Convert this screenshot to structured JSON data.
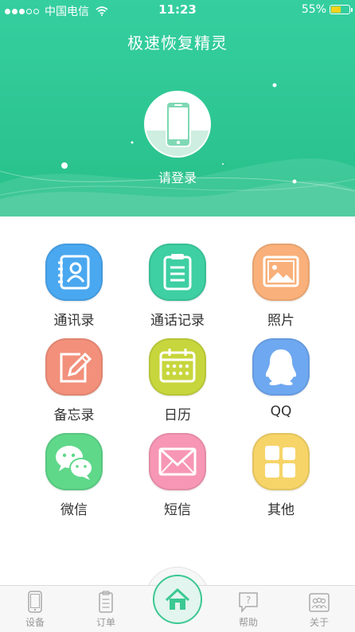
{
  "status_bar": {
    "carrier": "中国电信",
    "time": "11:23",
    "battery_percent": "55%",
    "battery_level": 0.55,
    "signal_icon": "signal-dots-icon",
    "wifi_icon": "wifi-icon"
  },
  "header": {
    "title": "极速恢复精灵",
    "login_label": "请登录",
    "avatar_icon": "phone-icon",
    "background_color": "#2dc692"
  },
  "features": [
    {
      "label": "通讯录",
      "icon": "contacts-book-icon",
      "color": "#4aa8f0"
    },
    {
      "label": "通话记录",
      "icon": "clipboard-list-icon",
      "color": "#3ecfa2"
    },
    {
      "label": "照片",
      "icon": "picture-icon",
      "color": "#f9b07a"
    },
    {
      "label": "备忘录",
      "icon": "note-pencil-icon",
      "color": "#f2907b"
    },
    {
      "label": "日历",
      "icon": "calendar-icon",
      "color": "#c7d63c"
    },
    {
      "label": "QQ",
      "icon": "qq-penguin-icon",
      "color": "#6ea8f0"
    },
    {
      "label": "微信",
      "icon": "wechat-icon",
      "color": "#5fd88a"
    },
    {
      "label": "短信",
      "icon": "envelope-icon",
      "color": "#f797b5"
    },
    {
      "label": "其他",
      "icon": "grid-blocks-icon",
      "color": "#f6d468"
    }
  ],
  "tabbar": {
    "tabs": [
      {
        "label": "设备",
        "icon": "phone-outline-icon"
      },
      {
        "label": "订单",
        "icon": "order-list-icon"
      },
      {
        "label": "帮助",
        "icon": "help-bubble-icon"
      },
      {
        "label": "关于",
        "icon": "people-group-icon"
      }
    ],
    "home_icon": "home-icon",
    "accent_color": "#3bc893"
  }
}
